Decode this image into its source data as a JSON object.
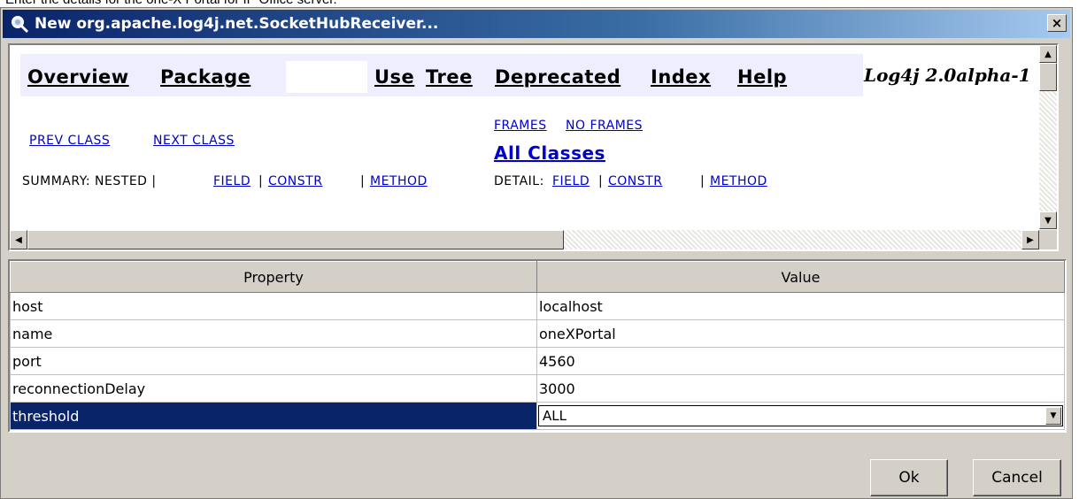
{
  "caption": "Enter the details for the one-X Portal for IP Office server.",
  "window": {
    "title": "New org.apache.log4j.net.SocketHubReceiver...",
    "close_label": "×"
  },
  "browser": {
    "nav": {
      "overview": "Overview",
      "package": "Package",
      "use": "Use",
      "tree": "Tree",
      "deprecated": "Deprecated",
      "index": "Index",
      "help": "Help"
    },
    "version": "Log4j 2.0alpha-1",
    "prev_class": "PREV CLASS",
    "next_class": "NEXT CLASS",
    "frames": "FRAMES",
    "no_frames": "NO FRAMES",
    "all_classes": "All Classes",
    "summary_prefix": "SUMMARY: NESTED |",
    "summary_field": "FIELD",
    "summary_constr": "CONSTR",
    "summary_method": "METHOD",
    "detail_prefix": "DETAIL:",
    "detail_field": "FIELD",
    "detail_constr": "CONSTR",
    "detail_method": "METHOD",
    "separator": "|"
  },
  "table": {
    "headers": [
      "Property",
      "Value"
    ],
    "rows": [
      {
        "property": "host",
        "value": "localhost"
      },
      {
        "property": "name",
        "value": "oneXPortal"
      },
      {
        "property": "port",
        "value": "4560"
      },
      {
        "property": "reconnectionDelay",
        "value": "3000"
      },
      {
        "property": "threshold",
        "value": "ALL"
      }
    ],
    "selected_row": "threshold"
  },
  "buttons": {
    "ok": "Ok",
    "cancel": "Cancel"
  },
  "colors": {
    "title_bar": "#0a246a",
    "selection": "#0a246a",
    "link": "#0000cc",
    "nav_background": "#eeeeff",
    "dialog_face": "#d4d0c8"
  },
  "icons": {
    "title": "search-magnifier-icon",
    "close": "close-icon",
    "scroll_up": "arrow-up-icon",
    "scroll_down": "arrow-down-icon",
    "scroll_left": "arrow-left-icon",
    "scroll_right": "arrow-right-icon",
    "combo": "chevron-down-icon"
  }
}
